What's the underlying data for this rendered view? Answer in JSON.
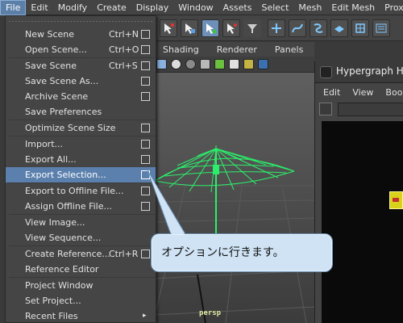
{
  "menubar": {
    "items": [
      "File",
      "Edit",
      "Modify",
      "Create",
      "Display",
      "Window",
      "Assets",
      "Select",
      "Mesh",
      "Edit Mesh",
      "Proxy"
    ]
  },
  "file_menu": {
    "items": [
      {
        "label": "New Scene",
        "shortcut": "Ctrl+N",
        "option_box": true
      },
      {
        "label": "Open Scene...",
        "shortcut": "Ctrl+O",
        "option_box": true
      },
      {
        "separator": true
      },
      {
        "label": "Save Scene",
        "shortcut": "Ctrl+S",
        "option_box": true
      },
      {
        "label": "Save Scene As...",
        "shortcut": "",
        "option_box": true
      },
      {
        "label": "Archive Scene",
        "shortcut": "",
        "option_box": true
      },
      {
        "label": "Save Preferences",
        "shortcut": "",
        "option_box": false
      },
      {
        "separator": true
      },
      {
        "label": "Optimize Scene Size",
        "shortcut": "",
        "option_box": true
      },
      {
        "separator": true
      },
      {
        "label": "Import...",
        "shortcut": "",
        "option_box": true
      },
      {
        "label": "Export All...",
        "shortcut": "",
        "option_box": true
      },
      {
        "label": "Export Selection...",
        "shortcut": "",
        "option_box": true,
        "highlighted": true
      },
      {
        "separator": true
      },
      {
        "label": "Export to Offline File...",
        "shortcut": "",
        "option_box": true
      },
      {
        "label": "Assign Offline File...",
        "shortcut": "",
        "option_box": true
      },
      {
        "separator": true
      },
      {
        "label": "View Image...",
        "shortcut": "",
        "option_box": false
      },
      {
        "label": "View Sequence...",
        "shortcut": "",
        "option_box": false
      },
      {
        "separator": true
      },
      {
        "label": "Create Reference...",
        "shortcut": "Ctrl+R",
        "option_box": true
      },
      {
        "label": "Reference Editor",
        "shortcut": "",
        "option_box": false
      },
      {
        "separator": true
      },
      {
        "label": "Project Window",
        "shortcut": "",
        "option_box": false
      },
      {
        "label": "Set Project...",
        "shortcut": "",
        "option_box": false
      },
      {
        "label": "Recent Files",
        "shortcut": "",
        "option_box": false,
        "submenu": true
      }
    ]
  },
  "viewport": {
    "menu": [
      "Shading",
      "Renderer",
      "Panels"
    ],
    "camera_label": "persp"
  },
  "hypergraph": {
    "title": "Hypergraph Hi",
    "menu": [
      "Edit",
      "View",
      "Bookm"
    ]
  },
  "callout": {
    "text": "オプションに行きます。"
  },
  "colors": {
    "accent": "#5b80ad",
    "wireframe": "#2bef6a",
    "callout_bg": "#cfe3f4",
    "node": "#d9d11a"
  }
}
